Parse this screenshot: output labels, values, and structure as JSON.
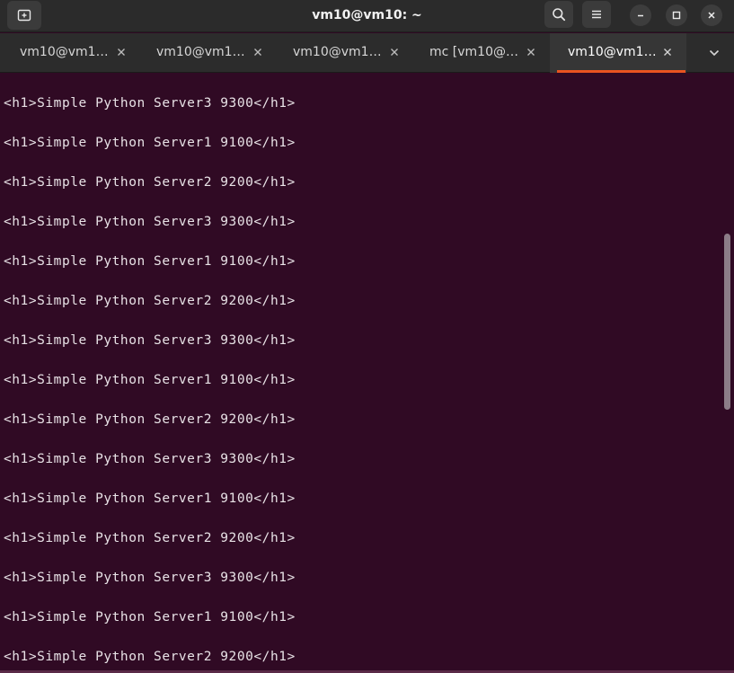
{
  "window": {
    "title": "vm10@vm10: ~",
    "new_tab_icon": "new-tab-icon",
    "search_icon": "search-icon",
    "menu_icon": "hamburger-menu-icon",
    "minimize_icon": "minimize-icon",
    "maximize_icon": "maximize-icon",
    "close_icon": "close-icon"
  },
  "tabs": [
    {
      "label": "vm10@vm10: ~",
      "active": false
    },
    {
      "label": "vm10@vm10: ~",
      "active": false
    },
    {
      "label": "vm10@vm10: ~",
      "active": false
    },
    {
      "label": "mc [vm10@vm10]:~",
      "active": false
    },
    {
      "label": "vm10@vm10: ~",
      "active": true
    }
  ],
  "terminal": {
    "lines": [
      "<h1>Simple Python Server3 9300</h1>",
      "<h1>Simple Python Server1 9100</h1>",
      "<h1>Simple Python Server2 9200</h1>",
      "<h1>Simple Python Server3 9300</h1>",
      "<h1>Simple Python Server1 9100</h1>",
      "<h1>Simple Python Server2 9200</h1>",
      "<h1>Simple Python Server3 9300</h1>",
      "<h1>Simple Python Server1 9100</h1>",
      "<h1>Simple Python Server2 9200</h1>",
      "<h1>Simple Python Server3 9300</h1>",
      "<h1>Simple Python Server1 9100</h1>",
      "<h1>Simple Python Server2 9200</h1>",
      "<h1>Simple Python Server3 9300</h1>",
      "<h1>Simple Python Server1 9100</h1>",
      "<h1>Simple Python Server2 9200</h1>"
    ]
  },
  "colors": {
    "terminal_bg": "#300a24",
    "titlebar_bg": "#2b2b2b",
    "accent": "#e95420",
    "text": "#e8e2e6"
  }
}
